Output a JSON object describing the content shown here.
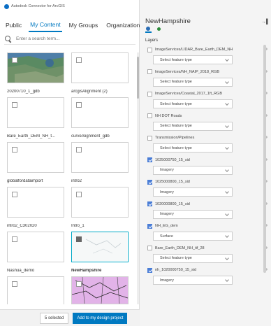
{
  "app": {
    "title": "Autodesk Connector for ArcGIS"
  },
  "tabs": [
    {
      "label": "Public"
    },
    {
      "label": "My Content"
    },
    {
      "label": "My Groups"
    },
    {
      "label": "Organization"
    }
  ],
  "search": {
    "placeholder": "Enter a search term..."
  },
  "items": [
    {
      "label": "20200710_1_gdb",
      "thumb": "image",
      "checked": false
    },
    {
      "label": "arcgisAlignment (2)",
      "thumb": "blank",
      "checked": false
    },
    {
      "label": "Bare_Earth_DEM_NH_t...",
      "thumb": "blank",
      "checked": false
    },
    {
      "label": "curveAlignment_gdb",
      "thumb": "blank",
      "checked": false
    },
    {
      "label": "globalfordataimport",
      "thumb": "blank",
      "checked": false
    },
    {
      "label": "intro2",
      "thumb": "blank",
      "checked": false
    },
    {
      "label": "intro2_C302020",
      "thumb": "blank",
      "checked": false
    },
    {
      "label": "Intro_1",
      "thumb": "blank",
      "checked": false
    },
    {
      "label": "Nashua_demo",
      "thumb": "blank",
      "checked": false
    },
    {
      "label": "NewHampshire",
      "thumb": "map",
      "checked": true
    },
    {
      "label": "",
      "thumb": "blank",
      "checked": false
    },
    {
      "label": "",
      "thumb": "pinkmap",
      "checked": false
    }
  ],
  "bottom": {
    "selected_label": "5 selected",
    "add_label": "Add to my design project"
  },
  "right": {
    "title": "NewHampshire",
    "section": "Layers",
    "pin_icon": "pin-icon"
  },
  "layers": [
    {
      "name": "ImageServices/LIDAR_Bare_Earth_DEM_NH",
      "checked": false,
      "select": "Select feature type"
    },
    {
      "name": "ImageServices/NH_NAIP_2018_RGB",
      "checked": false,
      "select": "Select feature type"
    },
    {
      "name": "ImageServices/Coastal_2017_1ft_RGB",
      "checked": false,
      "select": "Select feature type"
    },
    {
      "name": "NH DOT Roads",
      "checked": false,
      "select": "Select feature type"
    },
    {
      "name": "Transmission/Pipelines",
      "checked": false,
      "select": "Select feature type"
    },
    {
      "name": "1025000750_15_sid",
      "checked": true,
      "select": "Imagery"
    },
    {
      "name": "1025000800_15_sid",
      "checked": true,
      "select": "Imagery"
    },
    {
      "name": "1020000800_15_sid",
      "checked": true,
      "select": "Imagery"
    },
    {
      "name": "NH_EG_dem",
      "checked": true,
      "select": "Surface"
    },
    {
      "name": "Bare_Earth_DEM_NH_tif_28",
      "checked": false,
      "select": "Select feature type"
    },
    {
      "name": "nh_1020000750_15_sid",
      "checked": true,
      "select": "Imagery"
    }
  ],
  "colors": {
    "accent": "#0079c1",
    "selection": "#00a8c6",
    "check": "#4a7dd6"
  }
}
